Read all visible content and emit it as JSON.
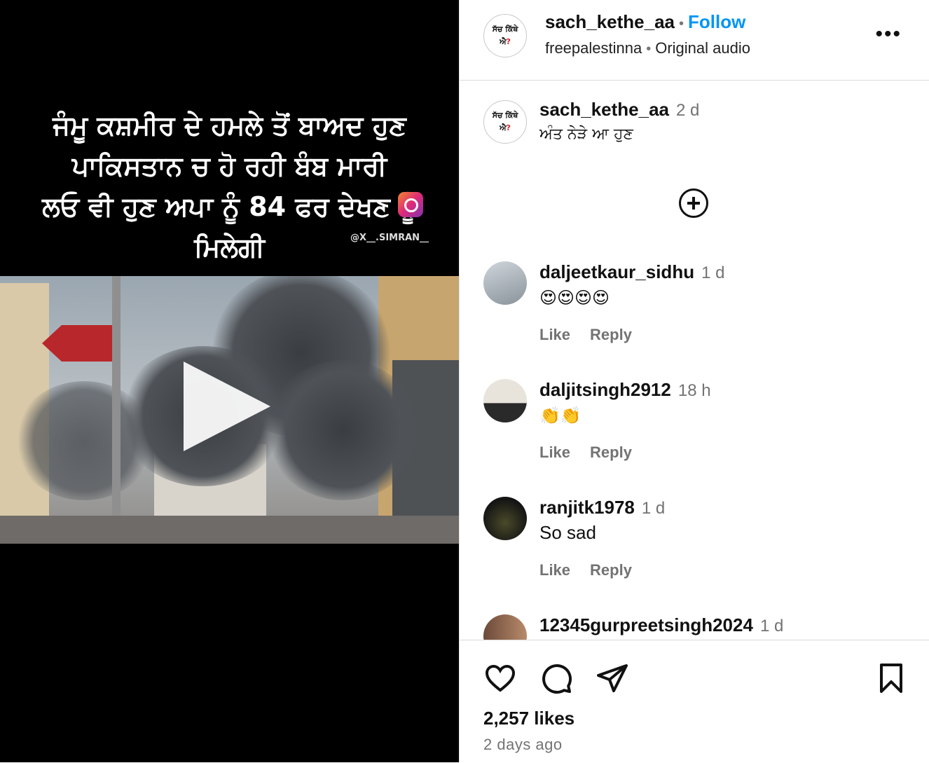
{
  "media": {
    "caption_lines": [
      "ਜੰਮੂ ਕਸ਼ਮੀਰ ਦੇ ਹਮਲੇ ਤੋਂ ਬਾਅਦ ਹੁਣ",
      "ਪਾਕਿਸਤਾਨ ਚ ਹੋ ਰਹੀ ਬੰਬ ਮਾਰੀ",
      "ਲਓ ਵੀ ਹੁਣ ਅਪਾ ਨੂੰ 84 ਫਰ ਦੇਖਣ ਨੂੰ",
      "ਮਿਲੇਗੀ"
    ],
    "watermark": "@X__.SIMRAN__"
  },
  "header": {
    "username": "sach_kethe_aa",
    "follow_label": "Follow",
    "tag": "freepalestinna",
    "audio": "Original audio",
    "avatar_text_top": "ਸੱਚ ਕਿੱਥੇ",
    "avatar_text_bottom": "ਐ",
    "avatar_q": "?"
  },
  "post_caption": {
    "username": "sach_kethe_aa",
    "time": "2 d",
    "text": "ਅੰਤ ਨੇੜੇ ਆ ਹੁਣ"
  },
  "comments": [
    {
      "username": "daljeetkaur_sidhu",
      "time": "1 d",
      "text": "😍😍😍😍",
      "like": "Like",
      "reply": "Reply"
    },
    {
      "username": "daljitsingh2912",
      "time": "18 h",
      "text": "👏👏",
      "like": "Like",
      "reply": "Reply"
    },
    {
      "username": "ranjitk1978",
      "time": "1 d",
      "text": "So sad",
      "like": "Like",
      "reply": "Reply"
    },
    {
      "username": "12345gurpreetsingh2024",
      "time": "1 d"
    }
  ],
  "footer": {
    "likes": "2,257 likes",
    "date": "2 days ago"
  },
  "colors": {
    "follow": "#0095f6",
    "muted": "#737373"
  },
  "icons": [
    "more-options-icon",
    "load-more-comments-icon",
    "heart-icon",
    "comment-icon",
    "share-icon",
    "bookmark-icon",
    "play-icon"
  ]
}
